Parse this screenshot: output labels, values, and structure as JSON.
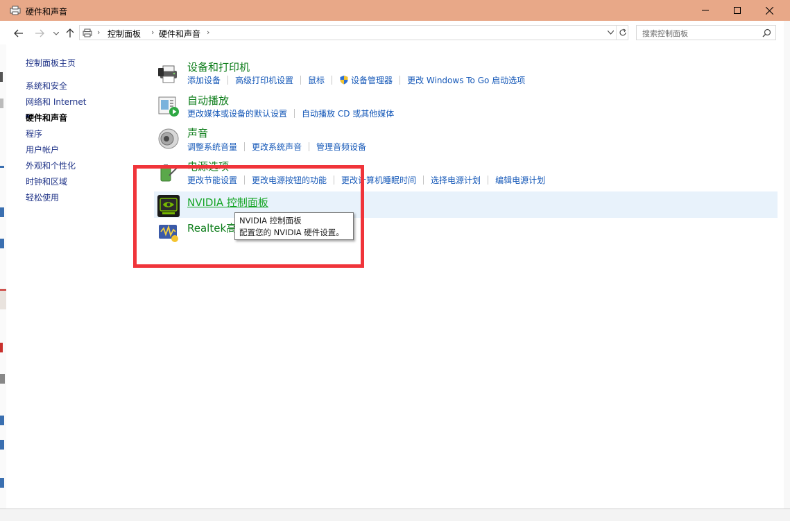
{
  "window": {
    "title": "硬件和声音"
  },
  "address_bar": {
    "breadcrumb": [
      "控制面板",
      "硬件和声音"
    ]
  },
  "search": {
    "placeholder": "搜索控制面板"
  },
  "sidebar": {
    "items": [
      {
        "label": "控制面板主页"
      },
      {
        "label": "系统和安全"
      },
      {
        "label": "网络和 Internet"
      },
      {
        "label": "硬件和声音",
        "current": true
      },
      {
        "label": "程序"
      },
      {
        "label": "用户帐户"
      },
      {
        "label": "外观和个性化"
      },
      {
        "label": "时钟和区域"
      },
      {
        "label": "轻松使用"
      }
    ]
  },
  "sections": [
    {
      "title": "设备和打印机",
      "icon": "printer-icon",
      "links": [
        "添加设备",
        "高级打印机设置",
        "鼠标",
        "设备管理器",
        "更改 Windows To Go 启动选项"
      ]
    },
    {
      "title": "自动播放",
      "icon": "autoplay-icon",
      "links": [
        "更改媒体或设备的默认设置",
        "自动播放 CD 或其他媒体"
      ]
    },
    {
      "title": "声音",
      "icon": "speaker-icon",
      "links": [
        "调整系统音量",
        "更改系统声音",
        "管理音频设备"
      ]
    },
    {
      "title": "电源选项",
      "icon": "power-options-icon",
      "links": [
        "更改节能设置",
        "更改电源按钮的功能",
        "更改计算机睡眠时间",
        "选择电源计划",
        "编辑电源计划"
      ]
    },
    {
      "title": "NVIDIA 控制面板",
      "icon": "nvidia-icon"
    },
    {
      "title": "Realtek高",
      "icon": "realtek-audio-icon"
    }
  ],
  "tooltip": {
    "line1": "NVIDIA 控制面板",
    "line2": "配置您的 NVIDIA 硬件设置。"
  },
  "colors": {
    "titlebar": "#e8a888",
    "section_title": "#0d7d1a",
    "link": "#1558b8",
    "annotation": "#f0343a"
  }
}
